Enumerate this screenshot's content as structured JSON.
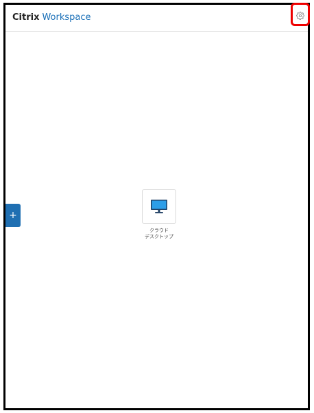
{
  "header": {
    "brand_primary": "Citrix",
    "brand_secondary": "Workspace"
  },
  "toolbar": {
    "settings_icon": "gear-icon",
    "settings_highlight": "red-outline"
  },
  "actions": {
    "add_label": "+"
  },
  "resources": [
    {
      "label": "クラウド\nデスクトップ",
      "icon": "monitor-icon"
    }
  ],
  "colors": {
    "brand_blue": "#1b70b8",
    "highlight_red": "#ee0000",
    "add_button_blue": "#1f6fb2",
    "border_gray": "#d8d8d8"
  }
}
